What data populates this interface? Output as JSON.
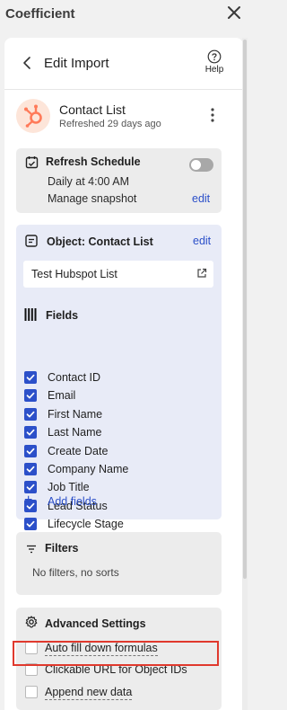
{
  "app": {
    "title": "Coefficient"
  },
  "header": {
    "title": "Edit Import",
    "help_label": "Help"
  },
  "source": {
    "name": "Contact List",
    "refreshed": "Refreshed 29 days ago"
  },
  "refresh_schedule": {
    "title": "Refresh Schedule",
    "schedule": "Daily at 4:00 AM",
    "snapshot": "Manage snapshot",
    "edit_label": "edit",
    "enabled": false
  },
  "object": {
    "title": "Object: Contact List",
    "edit_label": "edit",
    "list_name": "Test Hubspot List"
  },
  "fields": {
    "title": "Fields",
    "items": [
      "Contact ID",
      "Email",
      "First Name",
      "Last Name",
      "Create Date",
      "Company Name",
      "Job Title",
      "Lead Status",
      "Lifecycle Stage"
    ],
    "add_label": "Add fields"
  },
  "filters": {
    "title": "Filters",
    "summary": "No filters, no sorts"
  },
  "advanced": {
    "title": "Advanced Settings",
    "options": [
      {
        "label": "Auto fill down formulas",
        "checked": false
      },
      {
        "label": "Clickable URL for Object IDs",
        "checked": false
      },
      {
        "label": "Append new data",
        "checked": false
      }
    ]
  },
  "colors": {
    "accent": "#2c50c9",
    "brand": "#ff7a59",
    "highlight": "#e0392d"
  }
}
